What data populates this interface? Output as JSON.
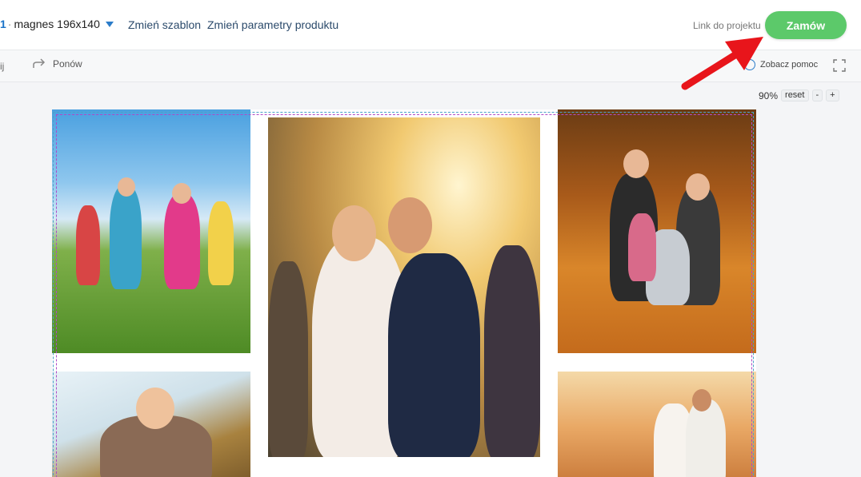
{
  "header": {
    "product_number": "1",
    "product_sep": "·",
    "product_name": "magnes 196x140",
    "change_template": "Zmień szablon",
    "change_params": "Zmień parametry produktu",
    "project_link": "Link do projektu",
    "order_button": "Zamów"
  },
  "toolbar": {
    "undo_fragment": "ij",
    "redo_label": "Ponów",
    "help_label": "Zobacz pomoc"
  },
  "zoom": {
    "level": "90%",
    "reset": "reset",
    "minus": "-",
    "plus": "+"
  },
  "colors": {
    "accent_green": "#5cc96a",
    "annotation_red": "#e8151b",
    "link_blue": "#2b7cc9"
  }
}
